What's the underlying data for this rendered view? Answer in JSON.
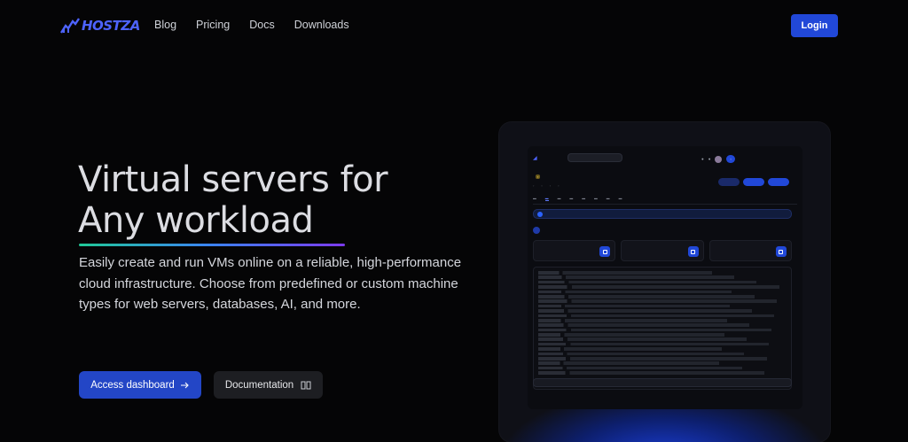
{
  "brand": {
    "name": "HOSTZA",
    "color": "#4d63ff"
  },
  "nav": {
    "links": [
      "Blog",
      "Pricing",
      "Docs",
      "Downloads"
    ],
    "login_label": "Login"
  },
  "hero": {
    "title_line1": "Virtual servers for",
    "title_line2": "Any workload",
    "description": "Easily create and run VMs online on a reliable, high-performance cloud infrastructure. Choose from predefined or custom machine types for web servers, databases, AI, and more.",
    "primary_cta": "Access dashboard",
    "secondary_cta": "Documentation"
  },
  "colors": {
    "accent": "#2148d8",
    "background": "#050506"
  }
}
